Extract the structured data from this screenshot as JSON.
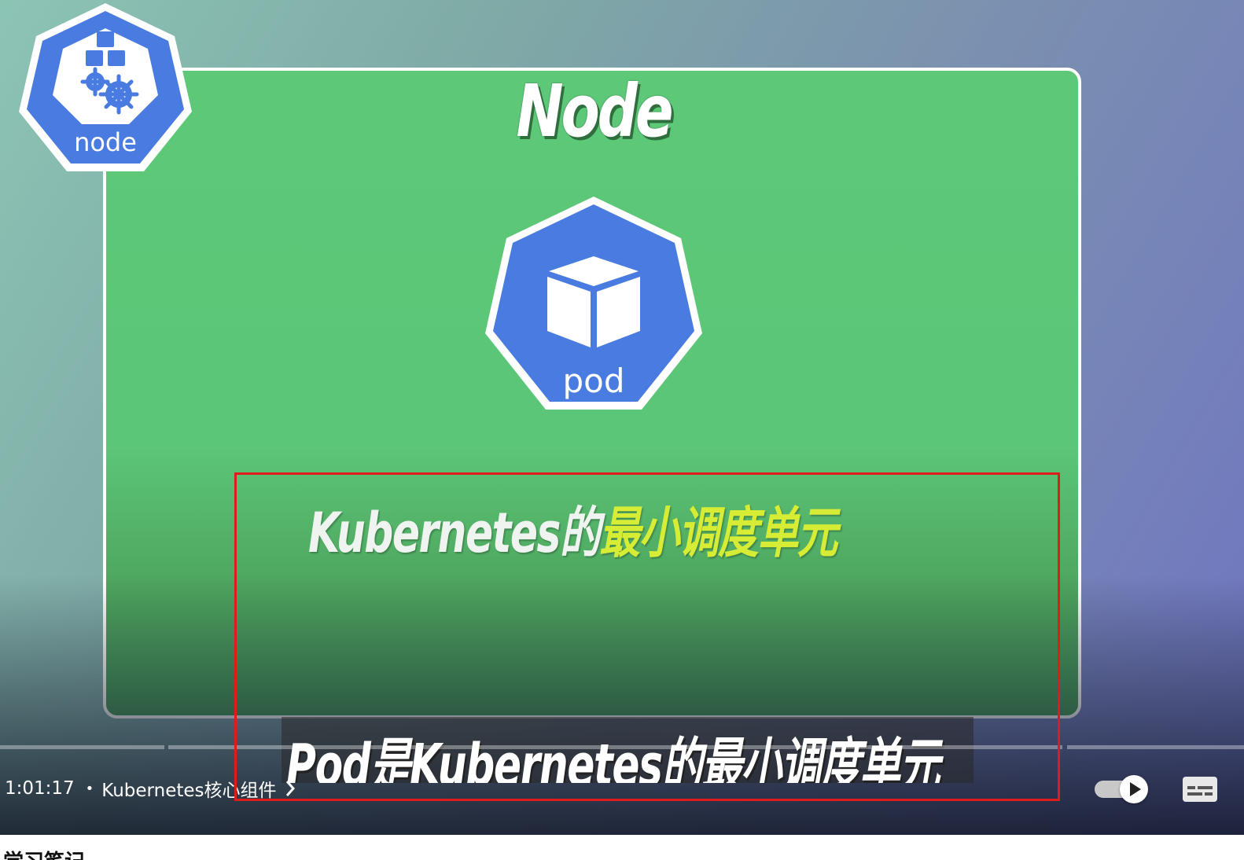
{
  "video": {
    "node_title": "Node",
    "node_badge_label": "node",
    "pod_badge_label": "pod",
    "caption": {
      "part_white": "Kubernetes的",
      "part_yellow": "最小调度单元"
    },
    "subtitle": "Pod是Kubernetes的最小调度单元",
    "colors": {
      "k8s_blue": "#4a7be0",
      "panel_green": "#5ec879",
      "caption_yellow": "#d6ec35",
      "highlight_red": "#e01b1b"
    }
  },
  "controls": {
    "time": "1:01:17",
    "separator": "•",
    "chapter_title": "Kubernetes核心组件",
    "chevron_icon": "chevron-right-icon",
    "autoplay_icon": "play-icon",
    "subtitles_icon": "subtitles-icon"
  },
  "below": {
    "partial_text": "学习笔记"
  }
}
